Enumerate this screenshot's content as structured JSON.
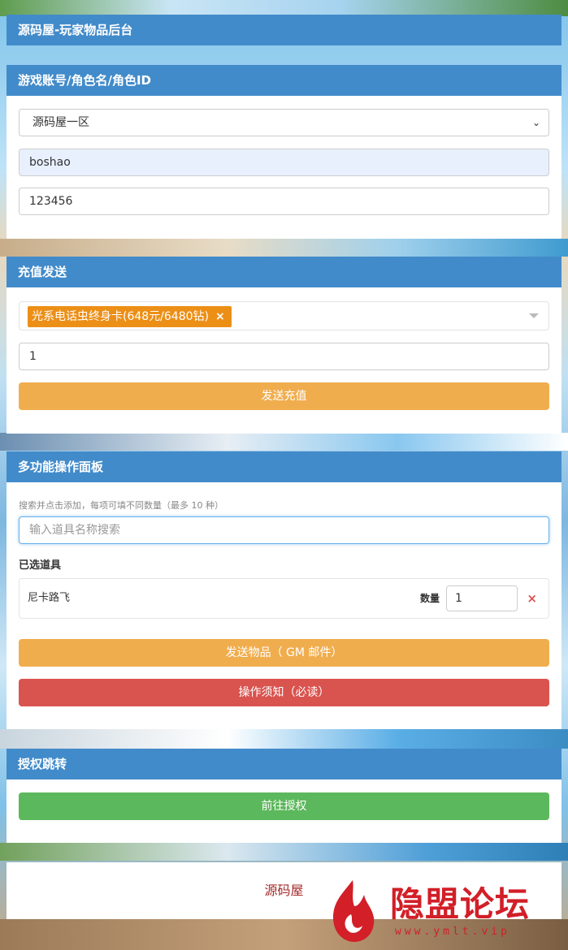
{
  "app": {
    "title": "源码屋-玩家物品后台"
  },
  "account_panel": {
    "title": "游戏账号/角色名/角色ID",
    "server_select": {
      "value": "源码屋一区"
    },
    "account_input": {
      "value": "boshao"
    },
    "role_id_input": {
      "value": "123456"
    }
  },
  "recharge_panel": {
    "title": "充值发送",
    "selected_tag": "光系电话虫终身卡(648元/6480钻)",
    "tag_remove": "×",
    "quantity_value": "1",
    "send_button": "发送充值"
  },
  "multi_panel": {
    "title": "多功能操作面板",
    "hint": "搜索并点击添加，每项可填不同数量（最多 10 种）",
    "search_placeholder": "输入道具名称搜索",
    "selected_label": "已选道具",
    "items": [
      {
        "name": "尼卡路飞",
        "qty_label": "数量",
        "qty": "1",
        "remove": "×"
      }
    ],
    "send_button": "发送物品（ GM 邮件）",
    "notice_button": "操作须知（必读）"
  },
  "auth_panel": {
    "title": "授权跳转",
    "goto_button": "前往授权"
  },
  "footer": {
    "text": "源码屋"
  },
  "watermark": {
    "text": "隐盟论坛",
    "url": "www.ymlt.vip",
    "color": "#d21f28"
  },
  "colors": {
    "header": "#428bca",
    "warning": "#f0ad4e",
    "danger": "#d9534f",
    "success": "#5cb85c",
    "tag": "#ec8f17"
  }
}
